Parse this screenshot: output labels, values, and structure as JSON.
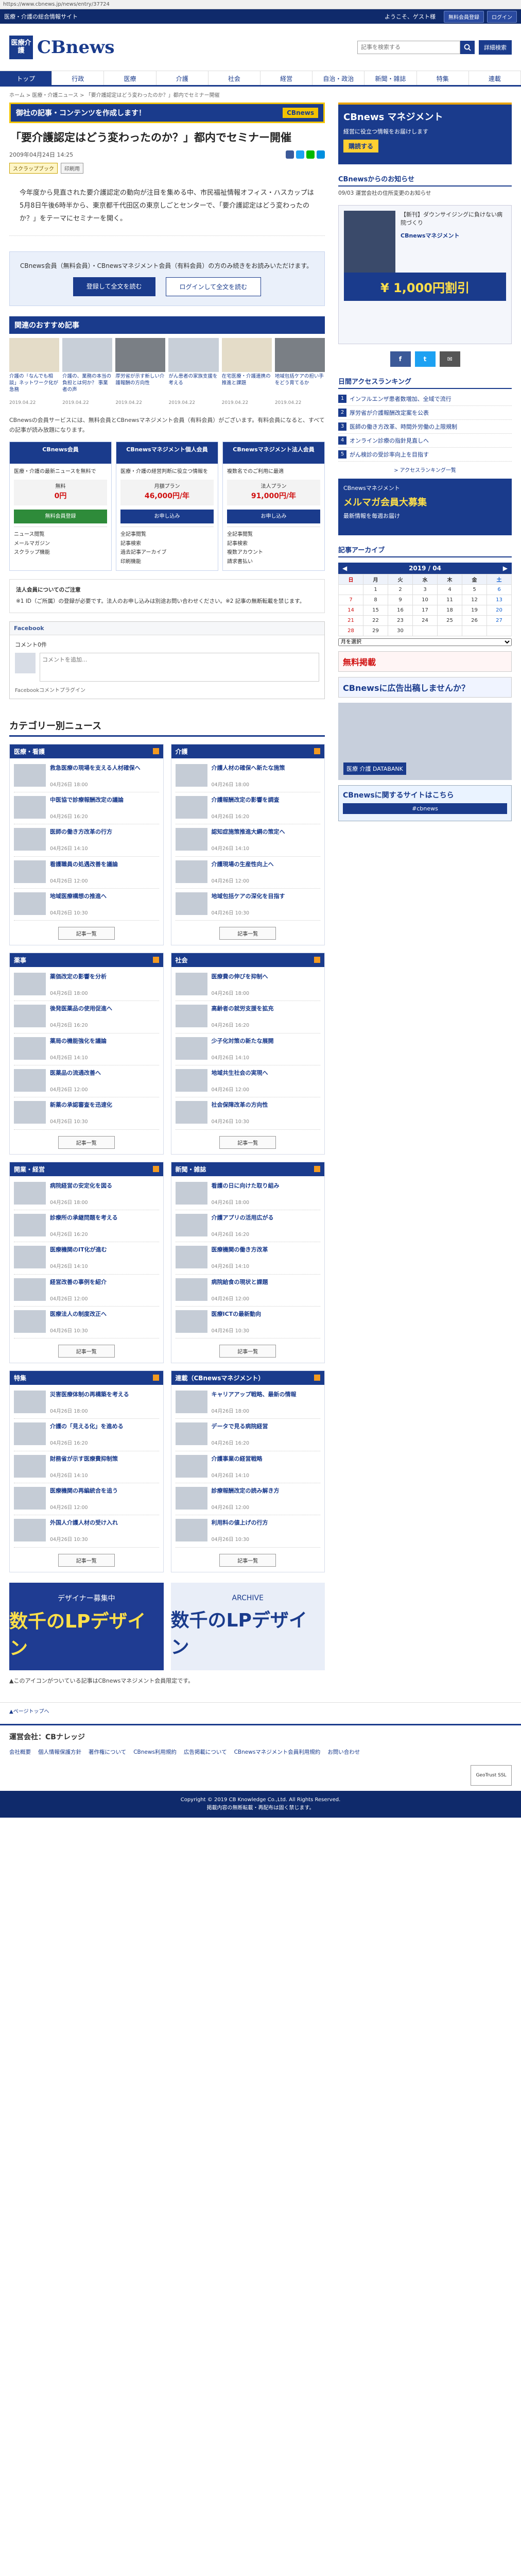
{
  "urlbar": "https://www.cbnews.jp/news/entry/37724",
  "topbar": {
    "tagline": "医療・介護の総合情報サイト",
    "welcome": "ようこそ、ゲスト様",
    "register": "無料会員登録",
    "login": "ログイン"
  },
  "header": {
    "logo_mark": "医療介護",
    "logo_name": "CBnews",
    "search_placeholder": "記事を検索する",
    "advanced": "詳細検索"
  },
  "nav": [
    "トップ",
    "行政",
    "医療",
    "介護",
    "社会",
    "経営",
    "自治・政治",
    "新聞・雑誌",
    "特集",
    "連載"
  ],
  "breadcrumb": "ホーム > 医療・介護ニュース > 「要介護認定はどう変わったのか？」都内でセミナー開催",
  "banner_top": {
    "text": "御社の記事・コンテンツを作成します！",
    "brand": "CBnews"
  },
  "article": {
    "title": "「要介護認定はどう変わったのか？」都内でセミナー開催",
    "date": "2009年04月24日 14:25",
    "tags": [
      "スクラップブック",
      "印刷用"
    ],
    "body": "今年度から見直された要介護認定の動向が注目を集める中、市民福祉情報オフィス・ハスカップは5月8日午後6時半から、東京都千代田区の東京しごとセンターで、「要介護認定はどう変わったのか？」をテーマにセミナーを開く。"
  },
  "login_box": {
    "text": "CBnews会員（無料会員）・CBnewsマネジメント会員（有料会員）の方のみ続きをお読みいただけます。",
    "register_btn": "登録して全文を読む",
    "login_btn": "ログインして全文を読む"
  },
  "recommended": {
    "heading": "関連のおすすめ記事",
    "items": [
      {
        "title": "介護の「なんでも相談」ネットワーク化が急務",
        "date": "2019.04.22"
      },
      {
        "title": "介護の、業務の本当の負担とは何か？ 事業者の声",
        "date": "2019.04.22"
      },
      {
        "title": "厚労省が示す新しい介護報酬の方向性",
        "date": "2019.04.22"
      },
      {
        "title": "がん患者の家族支援を考える",
        "date": "2019.04.22"
      },
      {
        "title": "在宅医療・介護連携の推進と課題",
        "date": "2019.04.22"
      },
      {
        "title": "地域包括ケアの担い手をどう育てるか",
        "date": "2019.04.22"
      }
    ]
  },
  "plan_info": "CBnewsの会員サービスには、無料会員とCBnewsマネジメント会員（有料会員）がございます。有料会員になると、すべての記事が読み放題になります。",
  "plans": [
    {
      "name": "CBnews会員",
      "desc": "医療・介護の最新ニュースを無料で",
      "price_label": "無料",
      "price": "0円",
      "cta": "無料会員登録",
      "features": [
        "ニュース閲覧",
        "メールマガジン",
        "スクラップ機能"
      ]
    },
    {
      "name": "CBnewsマネジメント個人会員",
      "desc": "医療・介護の経営判断に役立つ情報を",
      "price_label": "月額プラン",
      "price": "46,000円/年",
      "cta": "お申し込み",
      "features": [
        "全記事閲覧",
        "記事検索",
        "過去記事アーカイブ",
        "印刷機能"
      ]
    },
    {
      "name": "CBnewsマネジメント法人会員",
      "desc": "複数名でのご利用に最適",
      "price_label": "法人プラン",
      "price": "91,000円/年",
      "cta": "お申し込み",
      "features": [
        "全記事閲覧",
        "記事検索",
        "複数アカウント",
        "請求書払い"
      ]
    }
  ],
  "note": {
    "title": "法人会員についてのご注意",
    "text": "※1 ID（ご所属）の登録が必要です。法人のお申し込みは別途お問い合わせください。※2 記事の無断転載を禁じます。"
  },
  "facebook": {
    "header": "Facebook",
    "count": "コメント0件",
    "placeholder": "コメントを追加...",
    "plugin": "Facebookコメントプラグイン"
  },
  "categories": {
    "heading": "カテゴリー別ニュース",
    "more": "記事一覧",
    "blocks": [
      {
        "name": "医療・看護",
        "items": [
          {
            "title": "救急医療の現場を支える人材確保へ",
            "date": "04月26日 18:00"
          },
          {
            "title": "中医協で診療報酬改定の議論",
            "date": "04月26日 16:20"
          },
          {
            "title": "医師の働き方改革の行方",
            "date": "04月26日 14:10"
          },
          {
            "title": "看護職員の処遇改善を議論",
            "date": "04月26日 12:00"
          },
          {
            "title": "地域医療構想の推進へ",
            "date": "04月26日 10:30"
          }
        ]
      },
      {
        "name": "介護",
        "items": [
          {
            "title": "介護人材の確保へ新たな施策",
            "date": "04月26日 18:00"
          },
          {
            "title": "介護報酬改定の影響を調査",
            "date": "04月26日 16:20"
          },
          {
            "title": "認知症施策推進大綱の策定へ",
            "date": "04月26日 14:10"
          },
          {
            "title": "介護現場の生産性向上へ",
            "date": "04月26日 12:00"
          },
          {
            "title": "地域包括ケアの深化を目指す",
            "date": "04月26日 10:30"
          }
        ]
      },
      {
        "name": "薬事",
        "items": [
          {
            "title": "薬価改定の影響を分析",
            "date": "04月26日 18:00"
          },
          {
            "title": "後発医薬品の使用促進へ",
            "date": "04月26日 16:20"
          },
          {
            "title": "薬局の機能強化を議論",
            "date": "04月26日 14:10"
          },
          {
            "title": "医薬品の流通改善へ",
            "date": "04月26日 12:00"
          },
          {
            "title": "新薬の承認審査を迅速化",
            "date": "04月26日 10:30"
          }
        ]
      },
      {
        "name": "社会",
        "items": [
          {
            "title": "医療費の伸びを抑制へ",
            "date": "04月26日 18:00"
          },
          {
            "title": "高齢者の就労支援を拡充",
            "date": "04月26日 16:20"
          },
          {
            "title": "少子化対策の新たな展開",
            "date": "04月26日 14:10"
          },
          {
            "title": "地域共生社会の実現へ",
            "date": "04月26日 12:00"
          },
          {
            "title": "社会保障改革の方向性",
            "date": "04月26日 10:30"
          }
        ]
      },
      {
        "name": "開業・経営",
        "items": [
          {
            "title": "病院経営の安定化を図る",
            "date": "04月26日 18:00"
          },
          {
            "title": "診療所の承継問題を考える",
            "date": "04月26日 16:20"
          },
          {
            "title": "医療機関のIT化が進む",
            "date": "04月26日 14:10"
          },
          {
            "title": "経営改善の事例を紹介",
            "date": "04月26日 12:00"
          },
          {
            "title": "医療法人の制度改正へ",
            "date": "04月26日 10:30"
          }
        ]
      },
      {
        "name": "新聞・雑誌",
        "items": [
          {
            "title": "看護の日に向けた取り組み",
            "date": "04月26日 18:00"
          },
          {
            "title": "介護アプリの活用広がる",
            "date": "04月26日 16:20"
          },
          {
            "title": "医療機関の働き方改革",
            "date": "04月26日 14:10"
          },
          {
            "title": "病院給食の現状と課題",
            "date": "04月26日 12:00"
          },
          {
            "title": "医療ICTの最新動向",
            "date": "04月26日 10:30"
          }
        ]
      },
      {
        "name": "特集",
        "items": [
          {
            "title": "災害医療体制の再構築を考える",
            "date": "04月26日 18:00"
          },
          {
            "title": "介護の「見える化」を進める",
            "date": "04月26日 16:20"
          },
          {
            "title": "財務省が示す医療費抑制策",
            "date": "04月26日 14:10"
          },
          {
            "title": "医療機関の再編統合を追う",
            "date": "04月26日 12:00"
          },
          {
            "title": "外国人介護人材の受け入れ",
            "date": "04月26日 10:30"
          }
        ]
      },
      {
        "name": "連載（CBnewsマネジメント）",
        "items": [
          {
            "title": "キャリアアップ戦略、最新の情報",
            "date": "04月26日 18:00"
          },
          {
            "title": "データで見る病院経営",
            "date": "04月26日 16:20"
          },
          {
            "title": "介護事業の経営戦略",
            "date": "04月26日 14:10"
          },
          {
            "title": "診療報酬改定の読み解き方",
            "date": "04月26日 12:00"
          },
          {
            "title": "利用料の値上げの行方",
            "date": "04月26日 10:30"
          }
        ]
      }
    ]
  },
  "bottom_ads": [
    {
      "t1": "デザイナー募集中",
      "t2": "数千のLPデザイン"
    },
    {
      "t1": "ARCHIVE",
      "t2": "数千のLPデザイン"
    }
  ],
  "bottom_note": "▲このアイコンがついている記事はCBnewsマネジメント会員限定です。",
  "side": {
    "ad1": {
      "t1": "CBnews マネジメント",
      "t2": "経営に役立つ情報をお届けします",
      "t3": "購読する"
    },
    "notice_head": "CBnewsからのお知らせ",
    "notice": "09/03 運営会社の住所変更のお知らせ",
    "ad2": {
      "t1": "【新刊】ダウンサイジングに負けない病院づくり",
      "t2": "CBnewsマネジメント",
      "t3": "¥ 1,000円割引"
    },
    "social": [
      "f",
      "t",
      "✉"
    ],
    "rank_head": "日間アクセスランキング",
    "rank": [
      "インフルエンザ患者数増加、全域で流行",
      "厚労省が介護報酬改定案を公表",
      "医師の働き方改革、時間外労働の上限規制",
      "オンライン診療の指針見直しへ",
      "がん検診の受診率向上を目指す"
    ],
    "rank_more": "> アクセスランキング一覧",
    "ad3": {
      "t1": "CBnewsマネジメント",
      "t2": "メルマガ会員大募集",
      "t3": "最新情報を毎週お届け"
    },
    "cal_head": "記事アーカイブ",
    "cal_month": "2019 / 04",
    "cal_days": [
      "日",
      "月",
      "火",
      "水",
      "木",
      "金",
      "土"
    ],
    "cal_select": "月を選択",
    "bn1": "無料掲載",
    "bn2": "CBnewsに広告出稿しませんか？",
    "ad4": "医療 介護 DATABANK",
    "bn3": {
      "t1": "CBnewsに関するサイトはこちら",
      "t2": "#cbnews"
    }
  },
  "footer": {
    "pagetop": "▲ページトップへ",
    "company": "運営会社：CBナレッジ",
    "links": [
      "会社概要",
      "個人情報保護方針",
      "著作権について",
      "CBnews利用規約",
      "広告掲載について",
      "CBnewsマネジメント会員利用規約",
      "お問い合わせ"
    ],
    "cert": "GeoTrust SSL",
    "copy1": "Copyright © 2019 CB Knowledge Co.,Ltd. All Rights Reserved.",
    "copy2": "掲載内容の無断転載・再配布は固く禁じます。"
  }
}
